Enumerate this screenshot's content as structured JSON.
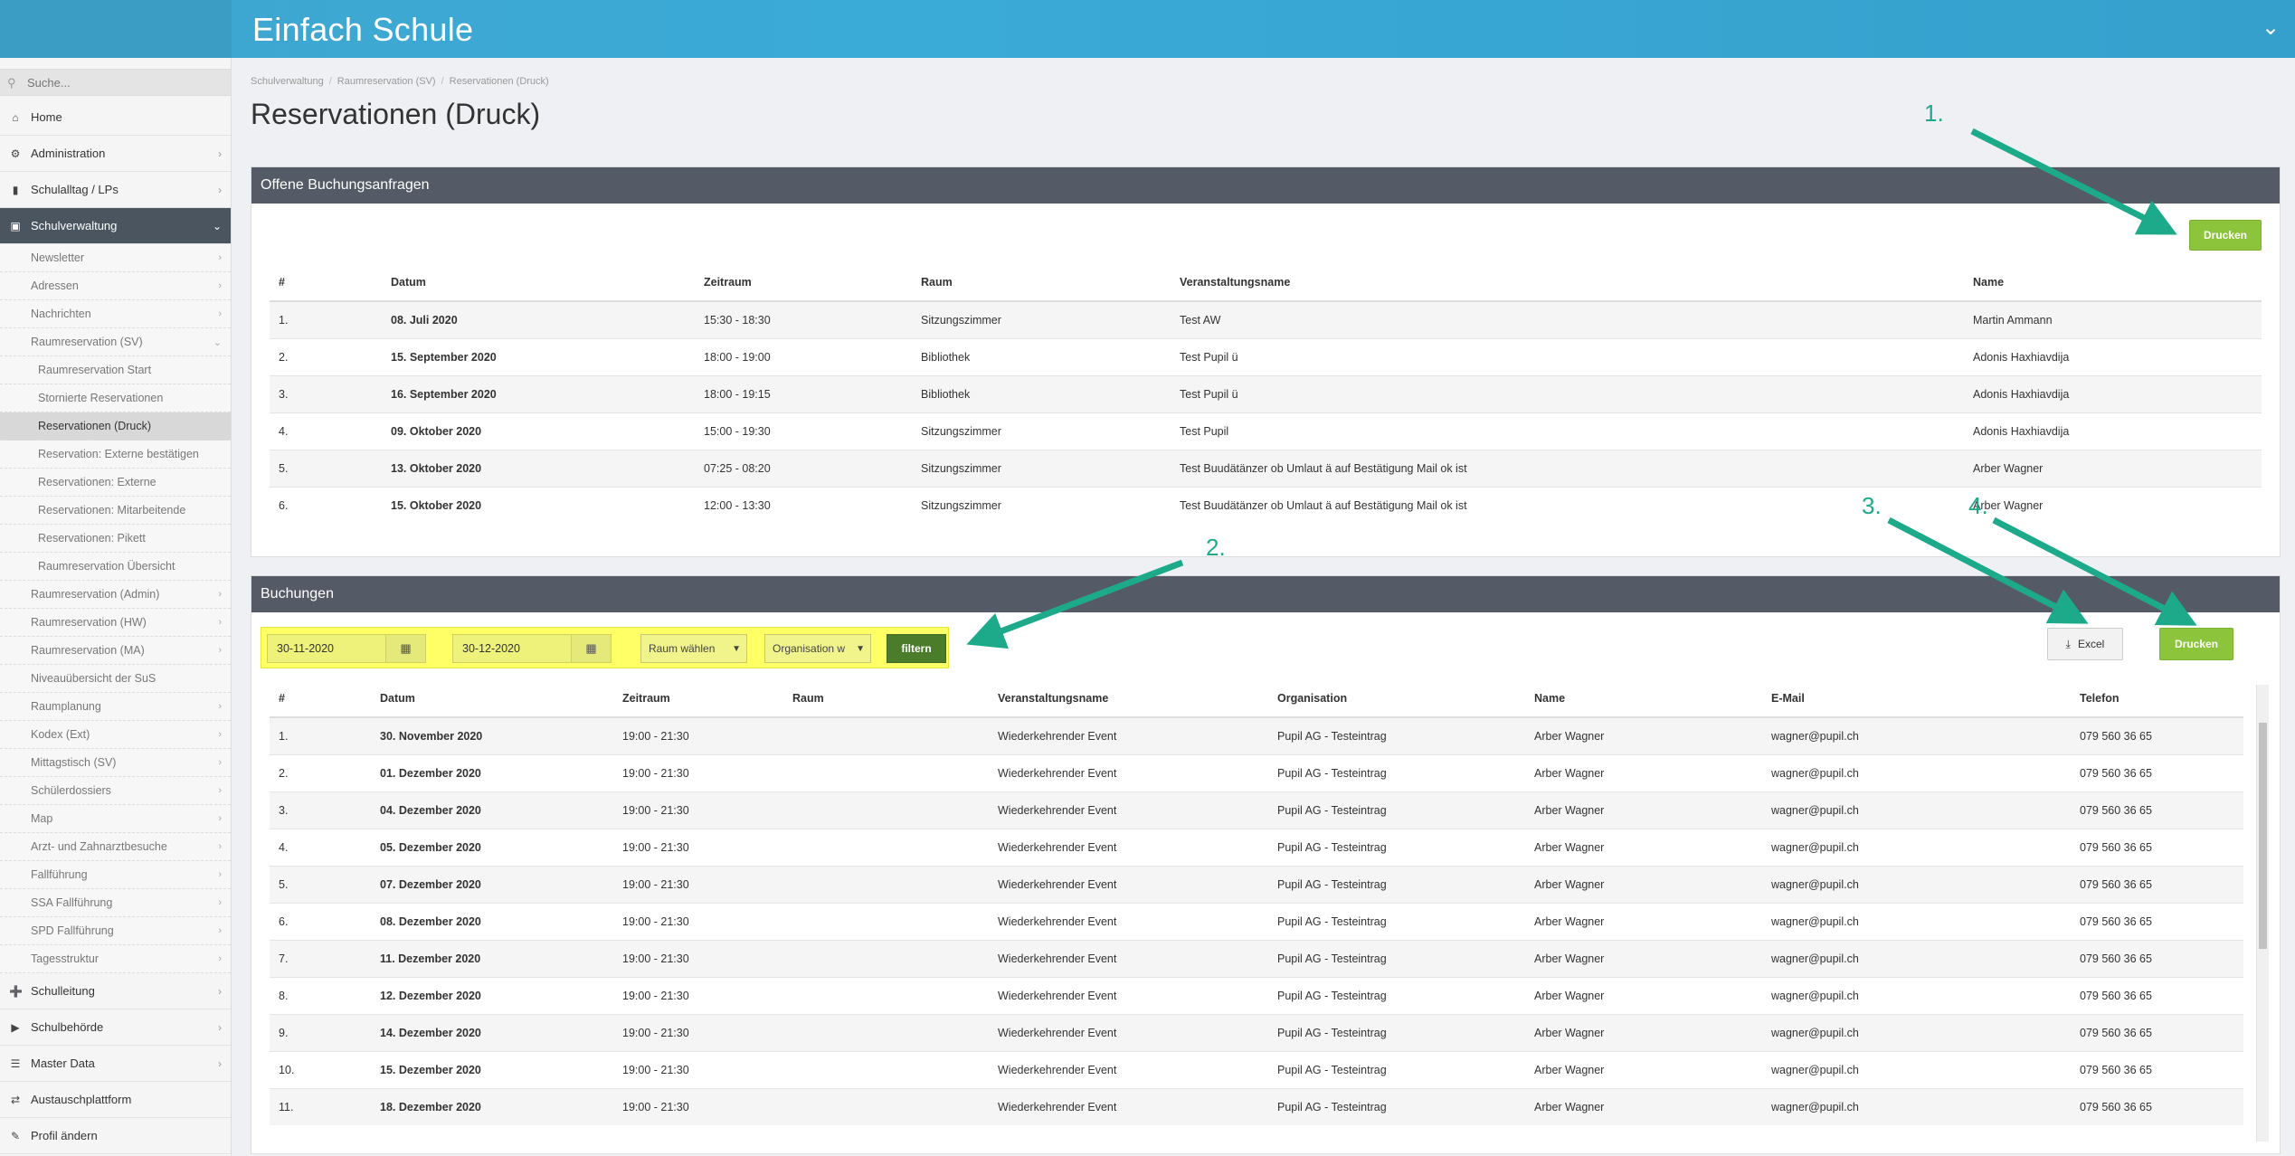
{
  "app": {
    "title": "Einfach Schule"
  },
  "sidebar": {
    "search_placeholder": "Suche...",
    "main_top": [
      {
        "label": "Home",
        "icon": "home-icon"
      },
      {
        "label": "Administration",
        "icon": "cogs-icon"
      },
      {
        "label": "Schulalltag / LPs",
        "icon": "bookmark-icon"
      },
      {
        "label": "Schulverwaltung",
        "icon": "folder-open-icon"
      }
    ],
    "sub_items_a": [
      "Newsletter",
      "Adressen",
      "Nachrichten",
      "Raumreservation (SV)"
    ],
    "sub2_items": [
      "Raumreservation Start",
      "Stornierte Reservationen",
      "Reservationen (Druck)",
      "Reservation: Externe bestätigen",
      "Reservationen: Externe",
      "Reservationen: Mitarbeitende",
      "Reservationen: Pikett",
      "Raumreservation Übersicht"
    ],
    "sub_items_b": [
      "Raumreservation (Admin)",
      "Raumreservation (HW)",
      "Raumreservation (MA)",
      "Niveauübersicht der SuS",
      "Raumplanung",
      "Kodex (Ext)",
      "Mittagstisch (SV)",
      "Schülerdossiers",
      "Map",
      "Arzt- und Zahnarztbesuche",
      "Fallführung",
      "SSA Fallführung",
      "SPD Fallführung",
      "Tagesstruktur"
    ],
    "main_bottom": [
      {
        "label": "Schulleitung",
        "icon": "signpost-icon"
      },
      {
        "label": "Schulbehörde",
        "icon": "bullhorn-icon"
      },
      {
        "label": "Master Data",
        "icon": "database-icon"
      },
      {
        "label": "Austauschplattform",
        "icon": "exchange-icon"
      },
      {
        "label": "Profil ändern",
        "icon": "pencil-icon"
      }
    ]
  },
  "breadcrumb": [
    "Schulverwaltung",
    "Raumreservation (SV)",
    "Reservationen (Druck)"
  ],
  "page_title": "Reservationen (Druck)",
  "open_requests": {
    "title": "Offene Buchungsanfragen",
    "print_label": "Drucken",
    "headers": [
      "#",
      "Datum",
      "Zeitraum",
      "Raum",
      "Veranstaltungsname",
      "Name"
    ],
    "rows": [
      [
        "1.",
        "08. Juli 2020",
        "15:30 - 18:30",
        "Sitzungszimmer",
        "Test AW",
        "Martin Ammann"
      ],
      [
        "2.",
        "15. September 2020",
        "18:00 - 19:00",
        "Bibliothek",
        "Test Pupil ü",
        "Adonis Haxhiavdija"
      ],
      [
        "3.",
        "16. September 2020",
        "18:00 - 19:15",
        "Bibliothek",
        "Test Pupil ü",
        "Adonis Haxhiavdija"
      ],
      [
        "4.",
        "09. Oktober 2020",
        "15:00 - 19:30",
        "Sitzungszimmer",
        "Test Pupil",
        "Adonis Haxhiavdija"
      ],
      [
        "5.",
        "13. Oktober 2020",
        "07:25 - 08:20",
        "Sitzungszimmer",
        "Test Buudätänzer ob Umlaut ä auf Bestätigung Mail ok ist",
        "Arber Wagner"
      ],
      [
        "6.",
        "15. Oktober 2020",
        "12:00 - 13:30",
        "Sitzungszimmer",
        "Test Buudätänzer ob Umlaut ä auf Bestätigung Mail ok ist",
        "Arber Wagner"
      ]
    ]
  },
  "bookings": {
    "title": "Buchungen",
    "filter": {
      "date_from": "30-11-2020",
      "date_to": "30-12-2020",
      "room_select": "Raum wählen",
      "org_select": "Organisation w",
      "filter_label": "filtern"
    },
    "excel_label": "Excel",
    "print_label": "Drucken",
    "headers": [
      "#",
      "Datum",
      "Zeitraum",
      "Raum",
      "Veranstaltungsname",
      "Organisation",
      "Name",
      "E-Mail",
      "Telefon"
    ],
    "rows": [
      [
        "1.",
        "30. November 2020",
        "19:00 - 21:30",
        "",
        "Wiederkehrender Event",
        "Pupil AG - Testeintrag",
        "Arber Wagner",
        "wagner@pupil.ch",
        "079 560 36 65"
      ],
      [
        "2.",
        "01. Dezember 2020",
        "19:00 - 21:30",
        "",
        "Wiederkehrender Event",
        "Pupil AG - Testeintrag",
        "Arber Wagner",
        "wagner@pupil.ch",
        "079 560 36 65"
      ],
      [
        "3.",
        "04. Dezember 2020",
        "19:00 - 21:30",
        "",
        "Wiederkehrender Event",
        "Pupil AG - Testeintrag",
        "Arber Wagner",
        "wagner@pupil.ch",
        "079 560 36 65"
      ],
      [
        "4.",
        "05. Dezember 2020",
        "19:00 - 21:30",
        "",
        "Wiederkehrender Event",
        "Pupil AG - Testeintrag",
        "Arber Wagner",
        "wagner@pupil.ch",
        "079 560 36 65"
      ],
      [
        "5.",
        "07. Dezember 2020",
        "19:00 - 21:30",
        "",
        "Wiederkehrender Event",
        "Pupil AG - Testeintrag",
        "Arber Wagner",
        "wagner@pupil.ch",
        "079 560 36 65"
      ],
      [
        "6.",
        "08. Dezember 2020",
        "19:00 - 21:30",
        "",
        "Wiederkehrender Event",
        "Pupil AG - Testeintrag",
        "Arber Wagner",
        "wagner@pupil.ch",
        "079 560 36 65"
      ],
      [
        "7.",
        "11. Dezember 2020",
        "19:00 - 21:30",
        "",
        "Wiederkehrender Event",
        "Pupil AG - Testeintrag",
        "Arber Wagner",
        "wagner@pupil.ch",
        "079 560 36 65"
      ],
      [
        "8.",
        "12. Dezember 2020",
        "19:00 - 21:30",
        "",
        "Wiederkehrender Event",
        "Pupil AG - Testeintrag",
        "Arber Wagner",
        "wagner@pupil.ch",
        "079 560 36 65"
      ],
      [
        "9.",
        "14. Dezember 2020",
        "19:00 - 21:30",
        "",
        "Wiederkehrender Event",
        "Pupil AG - Testeintrag",
        "Arber Wagner",
        "wagner@pupil.ch",
        "079 560 36 65"
      ],
      [
        "10.",
        "15. Dezember 2020",
        "19:00 - 21:30",
        "",
        "Wiederkehrender Event",
        "Pupil AG - Testeintrag",
        "Arber Wagner",
        "wagner@pupil.ch",
        "079 560 36 65"
      ],
      [
        "11.",
        "18. Dezember 2020",
        "19:00 - 21:30",
        "",
        "Wiederkehrender Event",
        "Pupil AG - Testeintrag",
        "Arber Wagner",
        "wagner@pupil.ch",
        "079 560 36 65"
      ]
    ]
  },
  "annotations": [
    "1.",
    "2.",
    "3.",
    "4."
  ],
  "colors": {
    "header_blue": "#3aa8d4",
    "sidebar_active": "#4a5560",
    "panel_header": "#545b66",
    "button_green": "#8cc43c",
    "highlight_yellow": "#ffff66",
    "annotation_teal": "#1daa8a"
  }
}
